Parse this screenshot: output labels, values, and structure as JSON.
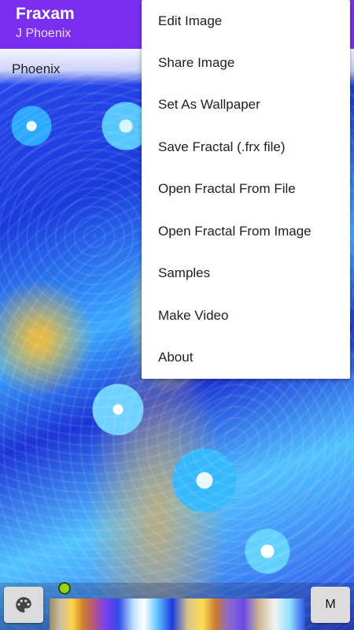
{
  "app": {
    "title": "Fraxam",
    "subtitle": "J Phoenix",
    "accent_color": "#7a2ff0"
  },
  "fractal": {
    "name_label": "Phoenix"
  },
  "menu": {
    "items": [
      "Edit Image",
      "Share Image",
      "Set As Wallpaper",
      "Save Fractal (.frx file)",
      "Open Fractal From File",
      "Open Fractal From Image",
      "Samples",
      "Make Video",
      "About"
    ]
  },
  "bottom": {
    "palette_icon": "palette-icon",
    "m_button_label": "M",
    "slider_value": 0.06
  }
}
